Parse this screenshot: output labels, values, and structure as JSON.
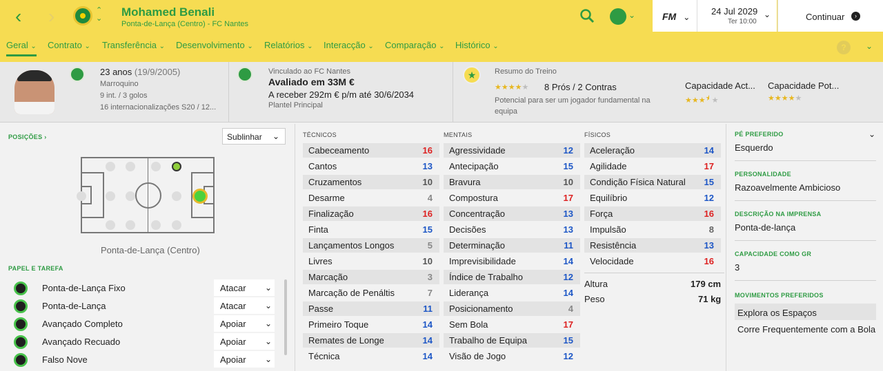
{
  "header": {
    "name": "Mohamed Benali",
    "subtitle": "Ponta-de-Lança (Centro) - FC Nantes",
    "fm": "FM",
    "date": "24 Jul 2029",
    "day": "Ter 10:00",
    "continue": "Continuar"
  },
  "tabs": [
    "Geral",
    "Contrato",
    "Transferência",
    "Desenvolvimento",
    "Relatórios",
    "Interacção",
    "Comparação",
    "Histórico"
  ],
  "overview": {
    "age": "23 anos",
    "birth": "(19/9/2005)",
    "nationality": "Marroquino",
    "caps": "9 int. / 3 golos",
    "youth": "16 internacionalizações S20 / 12...",
    "contract_label": "Vinculado ao FC Nantes",
    "value": "Avaliado em 33M €",
    "wage": "A receber 292m € p/m até 30/6/2034",
    "squad": "Plantel Principal",
    "training_label": "Resumo do Treino",
    "training_stars": 4,
    "pros_cons": "8 Prós / 2 Contras",
    "potential_note_1": "Potencial para ser um jogador fundamental na",
    "potential_note_2": "equipa",
    "current_ability": "Capacidade Act...",
    "current_stars": 3.5,
    "potential_ability": "Capacidade Pot...",
    "potential_stars": 4
  },
  "positions": {
    "label": "POSIÇÕES",
    "select": "Sublinhar",
    "position_name": "Ponta-de-Lança (Centro)"
  },
  "roles_label": "PAPEL E TAREFA",
  "roles": [
    {
      "name": "Ponta-de-Lança Fixo",
      "duty": "Atacar"
    },
    {
      "name": "Ponta-de-Lança",
      "duty": "Atacar"
    },
    {
      "name": "Avançado Completo",
      "duty": "Apoiar"
    },
    {
      "name": "Avançado Recuado",
      "duty": "Apoiar"
    },
    {
      "name": "Falso Nove",
      "duty": "Apoiar"
    }
  ],
  "technical_label": "TÉCNICOS",
  "technical": [
    [
      "Cabeceamento",
      16
    ],
    [
      "Cantos",
      13
    ],
    [
      "Cruzamentos",
      10
    ],
    [
      "Desarme",
      4
    ],
    [
      "Finalização",
      16
    ],
    [
      "Finta",
      15
    ],
    [
      "Lançamentos Longos",
      5
    ],
    [
      "Livres",
      10
    ],
    [
      "Marcação",
      3
    ],
    [
      "Marcação de Penáltis",
      7
    ],
    [
      "Passe",
      11
    ],
    [
      "Primeiro Toque",
      14
    ],
    [
      "Remates de Longe",
      14
    ],
    [
      "Técnica",
      14
    ]
  ],
  "mental_label": "MENTAIS",
  "mental": [
    [
      "Agressividade",
      12
    ],
    [
      "Antecipação",
      15
    ],
    [
      "Bravura",
      10
    ],
    [
      "Compostura",
      17
    ],
    [
      "Concentração",
      13
    ],
    [
      "Decisões",
      13
    ],
    [
      "Determinação",
      11
    ],
    [
      "Imprevisibilidade",
      14
    ],
    [
      "Índice de Trabalho",
      12
    ],
    [
      "Liderança",
      14
    ],
    [
      "Posicionamento",
      4
    ],
    [
      "Sem Bola",
      17
    ],
    [
      "Trabalho de Equipa",
      15
    ],
    [
      "Visão de Jogo",
      12
    ]
  ],
  "physical_label": "FÍSICOS",
  "physical": [
    [
      "Aceleração",
      14
    ],
    [
      "Agilidade",
      17
    ],
    [
      "Condição Física Natural",
      15
    ],
    [
      "Equilíbrio",
      12
    ],
    [
      "Força",
      16
    ],
    [
      "Impulsão",
      8
    ],
    [
      "Resistência",
      13
    ],
    [
      "Velocidade",
      16
    ]
  ],
  "body": {
    "height_label": "Altura",
    "height": "179 cm",
    "weight_label": "Peso",
    "weight": "71 kg"
  },
  "side": {
    "foot_label": "PÉ PREFERIDO",
    "foot": "Esquerdo",
    "personality_label": "PERSONALIDADE",
    "personality": "Razoavelmente Ambicioso",
    "press_label": "DESCRIÇÃO NA IMPRENSA",
    "press": "Ponta-de-lança",
    "gk_label": "CAPACIDADE COMO GR",
    "gk": "3",
    "moves_label": "MOVIMENTOS PREFERIDOS",
    "moves": [
      "Explora os Espaços",
      "Corre Frequentemente com a Bola"
    ]
  }
}
